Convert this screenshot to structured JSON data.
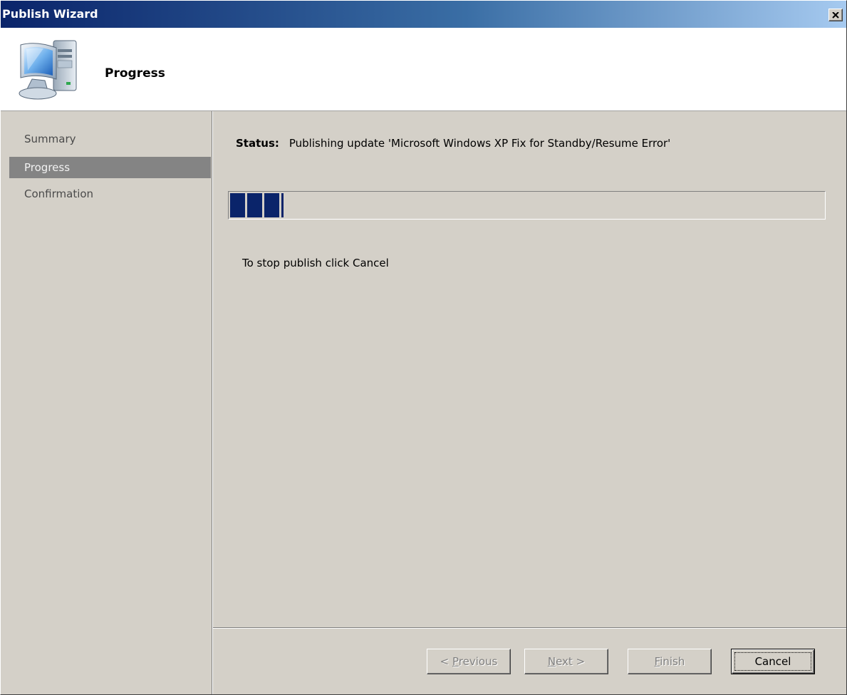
{
  "window": {
    "title": "Publish Wizard",
    "close_label": "Close"
  },
  "header": {
    "title": "Progress",
    "icon": "computer-monitor-icon"
  },
  "sidebar": {
    "items": [
      {
        "label": "Summary",
        "active": false
      },
      {
        "label": "Progress",
        "active": true
      },
      {
        "label": "Confirmation",
        "active": false
      }
    ]
  },
  "main": {
    "status_label": "Status:",
    "status_text": "Publishing update 'Microsoft Windows XP Fix for Standby/Resume Error'",
    "progress_fraction": 0.09,
    "hint": "To stop publish click Cancel"
  },
  "buttons": {
    "previous": {
      "prefix": "< ",
      "mnemonic": "P",
      "rest": "revious",
      "enabled": false
    },
    "next": {
      "prefix": "",
      "mnemonic": "N",
      "rest": "ext >",
      "enabled": false
    },
    "finish": {
      "prefix": "",
      "mnemonic": "F",
      "rest": "inish",
      "enabled": false
    },
    "cancel": {
      "prefix": "",
      "mnemonic": "",
      "rest": "Cancel",
      "enabled": true
    }
  },
  "colors": {
    "titlebar_start": "#0a246a",
    "titlebar_end": "#a6caf0",
    "progress_fill": "#0a246a",
    "selected_nav": "#848484",
    "dialog_face": "#d4d0c8"
  }
}
